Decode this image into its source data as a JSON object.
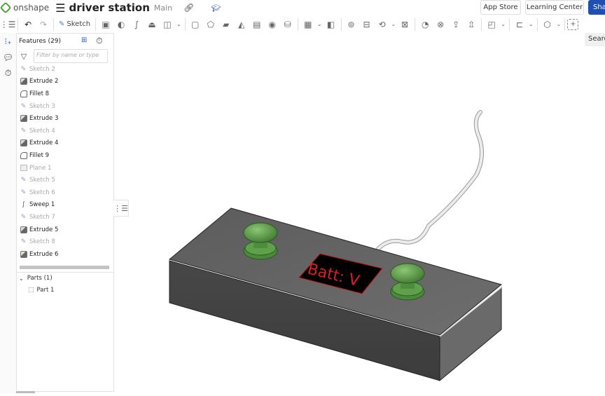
{
  "topbar": {
    "logo_text": "onshape",
    "document_title": "driver station",
    "branch": "Main",
    "app_store": "App Store",
    "learning_center": "Learning Center",
    "share": "Share"
  },
  "toolbar": {
    "sketch_label": "Sketch",
    "search_label": "Search"
  },
  "feature_panel": {
    "title": "Features (29)",
    "filter_placeholder": "Filter by name or type",
    "features": [
      {
        "name": "Sketch 2",
        "type": "sketch",
        "dimmed": true
      },
      {
        "name": "Extrude 2",
        "type": "extrude",
        "dimmed": false
      },
      {
        "name": "Fillet 8",
        "type": "fillet",
        "dimmed": false
      },
      {
        "name": "Sketch 3",
        "type": "sketch",
        "dimmed": true
      },
      {
        "name": "Extrude 3",
        "type": "extrude",
        "dimmed": false
      },
      {
        "name": "Sketch 4",
        "type": "sketch",
        "dimmed": true
      },
      {
        "name": "Extrude 4",
        "type": "extrude",
        "dimmed": false
      },
      {
        "name": "Fillet 9",
        "type": "fillet",
        "dimmed": false
      },
      {
        "name": "Plane 1",
        "type": "plane",
        "dimmed": true
      },
      {
        "name": "Sketch 5",
        "type": "sketch",
        "dimmed": true
      },
      {
        "name": "Sketch 6",
        "type": "sketch",
        "dimmed": true
      },
      {
        "name": "Sweep 1",
        "type": "sweep",
        "dimmed": false
      },
      {
        "name": "Sketch 7",
        "type": "sketch",
        "dimmed": true
      },
      {
        "name": "Extrude 5",
        "type": "extrude",
        "dimmed": false
      },
      {
        "name": "Sketch 8",
        "type": "sketch",
        "dimmed": true
      },
      {
        "name": "Extrude 6",
        "type": "extrude",
        "dimmed": false
      }
    ],
    "parts_header": "Parts (1)",
    "parts": [
      "Part 1"
    ]
  },
  "model": {
    "display_text": "Batt: V",
    "colors": {
      "body": "#5a5a5a",
      "joystick": "#5fa04a",
      "display": "#000000",
      "display_text": "#d8201c",
      "cable": "#e0e0e0"
    }
  }
}
